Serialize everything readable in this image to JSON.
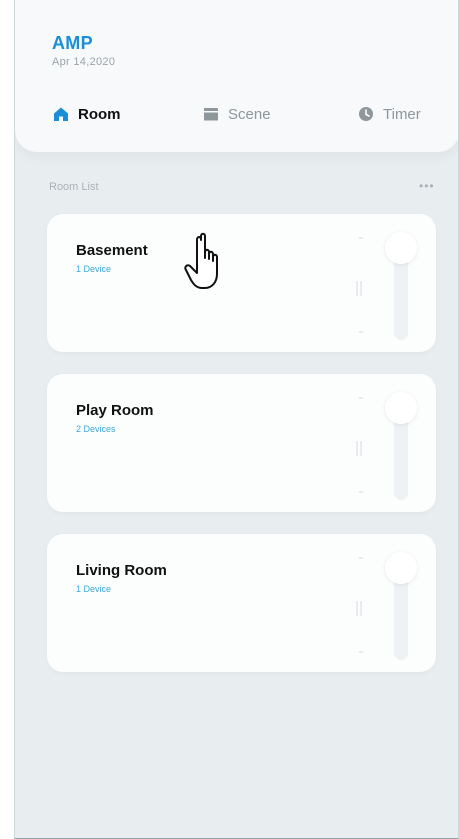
{
  "app": {
    "name": "AMP",
    "date": "Apr 14,2020"
  },
  "tabs": [
    {
      "label": "Room",
      "icon": "home-icon",
      "active": true
    },
    {
      "label": "Scene",
      "icon": "scene-icon",
      "active": false
    },
    {
      "label": "Timer",
      "icon": "clock-icon",
      "active": false
    }
  ],
  "room_list": {
    "label": "Room List",
    "more_icon": "more-icon",
    "rooms": [
      {
        "name": "Basement",
        "devices": "1 Device"
      },
      {
        "name": "Play Room",
        "devices": "2 Devices"
      },
      {
        "name": "Living Room",
        "devices": "1 Device"
      }
    ]
  },
  "colors": {
    "accent": "#1a8fd8",
    "device_count": "#39a9e0",
    "background": "#e8eef0",
    "card": "#fcfdfd"
  }
}
